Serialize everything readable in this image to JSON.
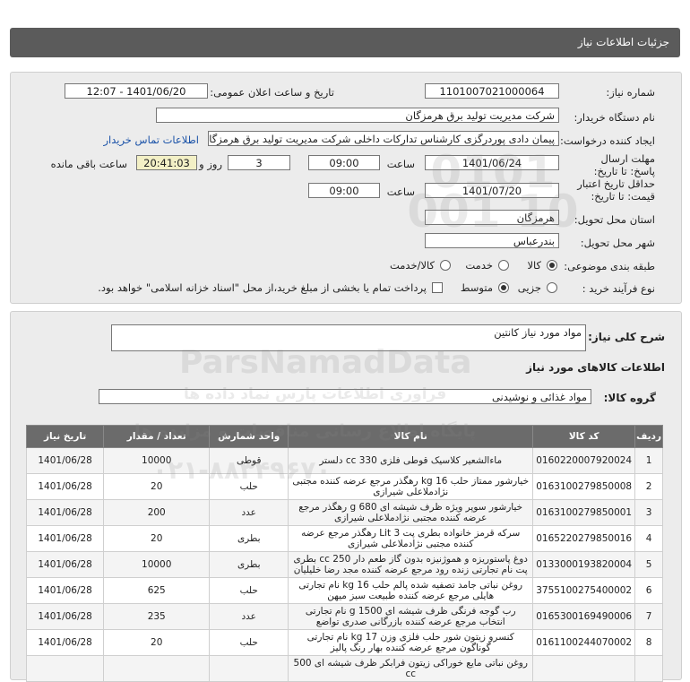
{
  "header": {
    "title": "جزئیات اطلاعات نیاز"
  },
  "form": {
    "need_number_label": "شماره نیاز:",
    "need_number": "1101007021000064",
    "announce_label": "تاریخ و ساعت اعلان عمومی:",
    "announce_value": "1401/06/20 - 12:07",
    "buyer_label": "نام دستگاه خریدار:",
    "buyer_value": "شرکت مدیریت تولید برق هرمزگان",
    "creator_label": "ایجاد کننده درخواست:",
    "creator_value": "پیمان دادی پوردرگزی کارشناس تدارکات داخلی شرکت مدیریت تولید برق هرمزگا",
    "contact_link": "اطلاعات تماس خریدار",
    "deadline_label": "مهلت ارسال پاسخ: تا تاریخ:",
    "deadline_date": "1401/06/24",
    "time_label": "ساعت",
    "deadline_time": "09:00",
    "days_value": "3",
    "days_label": "روز و",
    "remaining_time": "20:41:03",
    "remaining_label": "ساعت باقی مانده",
    "validity_label": "حداقل تاریخ اعتبار قیمت: تا تاریخ:",
    "validity_date": "1401/07/20",
    "validity_time_label": "ساعت",
    "validity_time": "09:00",
    "province_label": "استان محل تحویل:",
    "province_value": "هرمزگان",
    "city_label": "شهر محل تحویل:",
    "city_value": "بندرعباس",
    "category_label": "طبقه بندی موضوعی:",
    "category_options": [
      "کالا",
      "خدمت",
      "کالا/خدمت"
    ],
    "process_label": "نوع فرآیند خرید :",
    "process_options": [
      "جزیی",
      "متوسط"
    ],
    "payment_note": "پرداخت تمام یا بخشی از مبلغ خرید،از محل \"اسناد خزانه اسلامی\" خواهد بود."
  },
  "summary": {
    "desc_label": "شرح کلی نیاز:",
    "desc_value": "مواد مورد نیاز کانتین",
    "goods_info_title": "اطلاعات کالاهای مورد نیاز",
    "group_label": "گروه کالا:",
    "group_value": "مواد غذائی و نوشیدنی"
  },
  "table": {
    "headers": [
      "ردیف",
      "کد کالا",
      "نام کالا",
      "واحد شمارش",
      "تعداد / مقدار",
      "تاریخ نیاز"
    ],
    "rows": [
      [
        "1",
        "0160220007920024",
        "ماءالشعیر کلاسیک قوطی فلزی 330 cc دلستر",
        "قوطی",
        "10000",
        "1401/06/28"
      ],
      [
        "2",
        "0163100279850008",
        "خیارشور ممتاز حلب 16 kg رهگذر مرجع عرضه کننده مجتبی نژادملاعلی شیرازی",
        "حلب",
        "20",
        "1401/06/28"
      ],
      [
        "3",
        "0163100279850001",
        "خیارشور سوپر ویژه ظرف شیشه ای 680 g رهگذر مرجع عرضه کننده مجتبی نژادملاعلی شیرازی",
        "عدد",
        "200",
        "1401/06/28"
      ],
      [
        "4",
        "0165220279850016",
        "سرکه قرمز خانواده بطری پت 3 Lit رهگذر مرجع عرضه کننده مجتبی نژادملاعلی شیرازی",
        "بطری",
        "20",
        "1401/06/28"
      ],
      [
        "5",
        "0133000193820004",
        "دوغ پاستوریزه و هموژنیزه بدون گاز طعم دار 250 cc بطری پت نام تجارتی زنده رود مرجع عرضه کننده مجد رضا خلیلیان",
        "بطری",
        "10000",
        "1401/06/28"
      ],
      [
        "6",
        "3755100275400002",
        "روغن نباتی جامد تصفیه شده پالم حلب 16 kg نام تجارتی هایلی مرجع عرضه کننده طبیعت سبز میهن",
        "حلب",
        "625",
        "1401/06/28"
      ],
      [
        "7",
        "0165300169490006",
        "رب گوجه فرنگی ظرف شیشه ای 1500 g نام تجارتی انتخاب مرجع عرضه کننده بازرگانی صدری تواضع",
        "عدد",
        "235",
        "1401/06/28"
      ],
      [
        "8",
        "0161100244070002",
        "کنسرو زیتون شور حلب فلزی وزن 17 kg نام تجارتی گوناگون مرجع عرضه کننده بهار رنگ پالیز",
        "حلب",
        "20",
        "1401/06/28"
      ],
      [
        "",
        "",
        "روغن نباتی مایع خوراکی زیتون فرابکر ظرف شیشه ای 500 cc",
        "",
        "",
        ""
      ]
    ]
  },
  "watermark": {
    "main": "ParsNamadData",
    "line1": "پایگاه اطلاع رسانی مناقصات و مزایده ها",
    "line2": "فراوری اطلاعات پارس نماد داده ها",
    "phone": "۰۲۱-۸۸۳۴۹۶۷۰",
    "digits": "0101 001 10"
  }
}
